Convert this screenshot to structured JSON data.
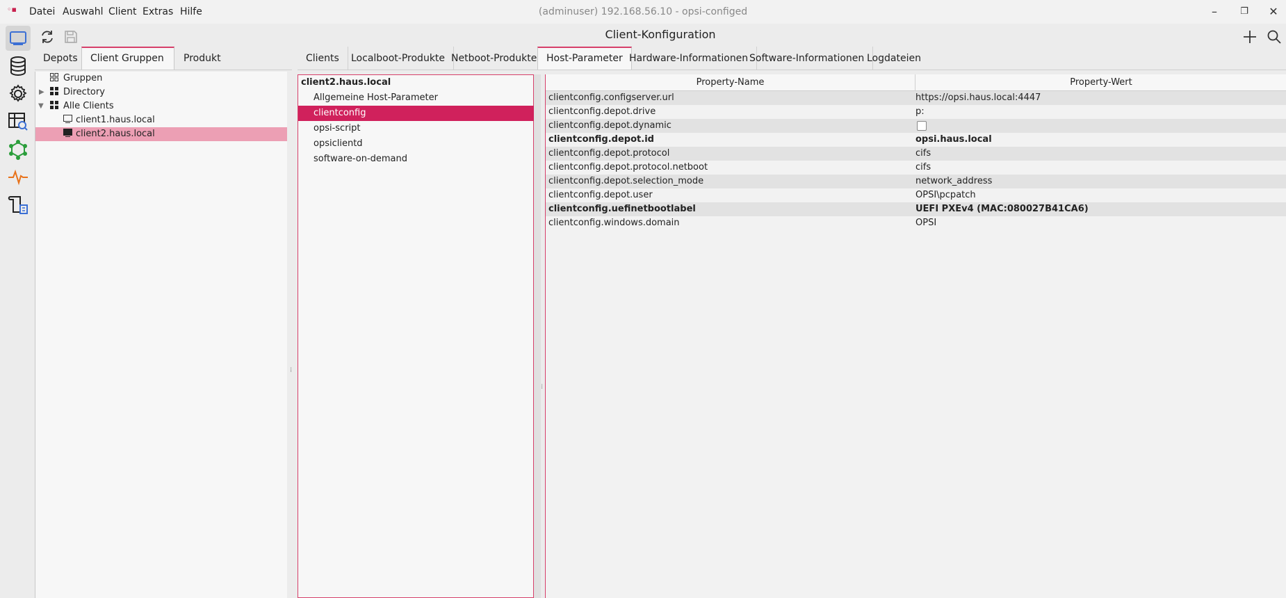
{
  "app": {
    "window_title": "(adminuser) 192.168.56.10 - opsi-configed",
    "menu": [
      "Datei",
      "Auswahl",
      "Client",
      "Extras",
      "Hilfe"
    ],
    "header_title": "Client-Konfiguration",
    "accent_color": "#d0215c"
  },
  "left_tabs": [
    "Depots",
    "Client Gruppen",
    "Produkt Gruppen"
  ],
  "main_tabs": [
    "Clients",
    "Localboot-Produkte",
    "Netboot-Produkte",
    "Host-Parameter",
    "Hardware-Informationen",
    "Software-Informationen",
    "Logdateien"
  ],
  "active_main_tab": "Host-Parameter",
  "tree": [
    {
      "label": "Gruppen",
      "icon": "grid-icon"
    },
    {
      "label": "Directory",
      "icon": "grid-filled-icon"
    },
    {
      "label": "Alle Clients",
      "icon": "grid-filled-icon"
    },
    {
      "label": "client1.haus.local",
      "icon": "monitor-icon"
    },
    {
      "label": "client2.haus.local",
      "icon": "monitor-filled-icon"
    }
  ],
  "categories": {
    "client": "client2.haus.local",
    "items": [
      "Allgemeine Host-Parameter",
      "clientconfig",
      "opsi-script",
      "opsiclientd",
      "software-on-demand"
    ]
  },
  "table": {
    "headers": [
      "Property-Name",
      "Property-Wert"
    ],
    "rows": [
      {
        "name": "clientconfig.configserver.url",
        "value": "https://opsi.haus.local:4447"
      },
      {
        "name": "clientconfig.depot.drive",
        "value": "p:"
      },
      {
        "name": "clientconfig.depot.dynamic",
        "value": ""
      },
      {
        "name": "clientconfig.depot.id",
        "value": "opsi.haus.local"
      },
      {
        "name": "clientconfig.depot.protocol",
        "value": "cifs"
      },
      {
        "name": "clientconfig.depot.protocol.netboot",
        "value": "cifs"
      },
      {
        "name": "clientconfig.depot.selection_mode",
        "value": "network_address"
      },
      {
        "name": "clientconfig.depot.user",
        "value": "OPSI\\pcpatch"
      },
      {
        "name": "clientconfig.uefinetbootlabel",
        "value": "UEFI PXEv4 (MAC:080027B41CA6)"
      },
      {
        "name": "clientconfig.windows.domain",
        "value": "OPSI"
      }
    ]
  }
}
